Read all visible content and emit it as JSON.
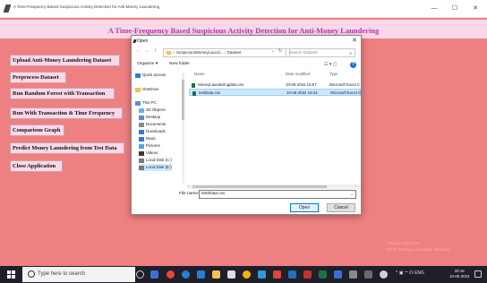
{
  "window": {
    "title": "A Time-Frequency Based Suspicious Activity Detection for Anti-Money Laundering",
    "minimize": "—",
    "maximize": "☐",
    "close": "✕"
  },
  "app": {
    "title": "A Time-Frequency Based Suspicious Activity Detection for Anti-Money Laundering",
    "buttons": [
      {
        "label": "Upload Anti-Money Laundering Dataset"
      },
      {
        "label": "Preprocess Dataset"
      },
      {
        "label": "Run Random Forest with Transaction"
      },
      {
        "label": "Run With Transaction & Time Frequency"
      },
      {
        "label": "Comparison Graph"
      },
      {
        "label": "Predict Money Laundering from Test Data"
      },
      {
        "label": "Close Application"
      }
    ]
  },
  "dialog": {
    "title": "Open",
    "close": "✕",
    "nav": {
      "back": "←",
      "forward": "→",
      "up": "↑"
    },
    "address": {
      "parts": [
        "«",
        "SuspiciousMoneyLaund...",
        "›",
        "Dataset"
      ],
      "dropdown": "⌄",
      "refresh": "↻"
    },
    "search_placeholder": "Search Dataset",
    "search_icon": "⌕",
    "toolbar": {
      "organize": "Organize ▾",
      "new_folder": "New folder",
      "view": "☷ ▾  ▢",
      "help": "?"
    },
    "nav_items": [
      {
        "label": "Quick access",
        "icon": "star-icon",
        "color": "#2f7bd6"
      },
      {
        "label": "OneDrive",
        "icon": "cloud-icon",
        "color": "#f2c04c"
      },
      {
        "label": "This PC",
        "icon": "computer-icon",
        "color": "#5a8fd6"
      },
      {
        "label": "3D Objects",
        "icon": "cube-icon",
        "color": "#6ab0e8"
      },
      {
        "label": "Desktop",
        "icon": "desktop-icon",
        "color": "#4a90d9"
      },
      {
        "label": "Documents",
        "icon": "documents-icon",
        "color": "#8a8a8a"
      },
      {
        "label": "Downloads",
        "icon": "download-icon",
        "color": "#2a7fd4"
      },
      {
        "label": "Music",
        "icon": "music-icon",
        "color": "#2a7fd4"
      },
      {
        "label": "Pictures",
        "icon": "pictures-icon",
        "color": "#5aa0d8"
      },
      {
        "label": "Videos",
        "icon": "videos-icon",
        "color": "#3a3a3a"
      },
      {
        "label": "Local Disk (C:)",
        "icon": "disk-icon",
        "color": "#7a7a7a"
      },
      {
        "label": "Local Disk (E:)",
        "icon": "disk-icon",
        "color": "#7a7a7a"
      }
    ],
    "columns": [
      "Name",
      "Date modified",
      "Type"
    ],
    "files": [
      {
        "name": "MoneyLaunderingdata.csv",
        "date": "10-06-2022 16:57",
        "type": "Microsoft Excel C"
      },
      {
        "name": "testData.csv",
        "date": "10-06-2022 16:44",
        "type": "Microsoft Excel C"
      }
    ],
    "file_name_label": "File name:",
    "file_name_value": "testData.csv",
    "open_label": "Open",
    "cancel_label": "Cancel"
  },
  "taskbar": {
    "search_placeholder": "Type here to search",
    "tray": "^ ▣ 𝄖 ☊ ENG",
    "time": "20:16",
    "date": "10-06-2022"
  },
  "watermark": [
    "Activate Windows",
    "Go to Settings to activate Windows."
  ]
}
